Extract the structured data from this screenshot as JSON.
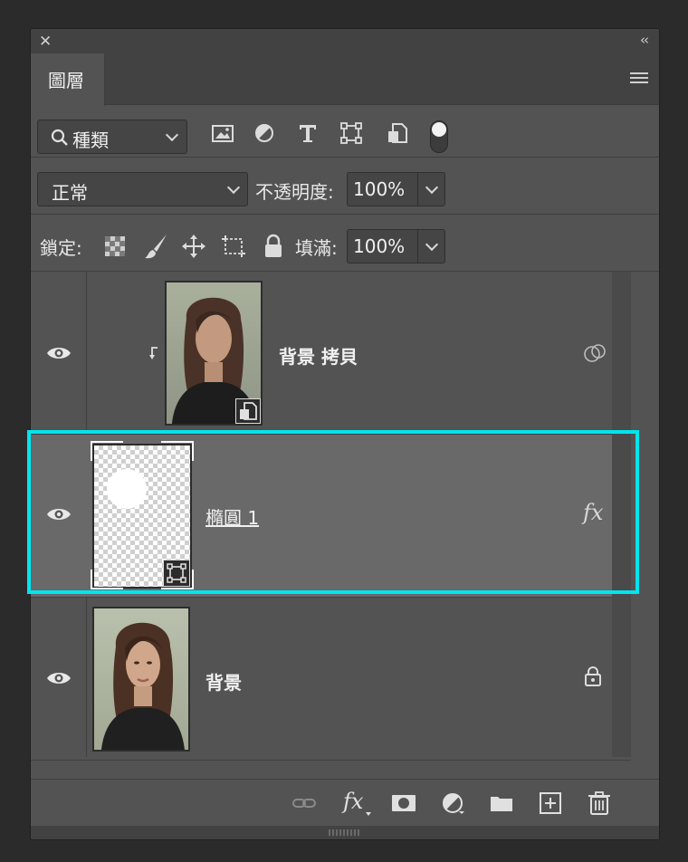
{
  "panel": {
    "tab_label": "圖層",
    "collapse_glyph": "‹‹",
    "close_glyph": "✕"
  },
  "filter": {
    "kind_label": "種類",
    "icons": [
      "image-filter-icon",
      "adjustment-filter-icon",
      "type-filter-icon",
      "shape-filter-icon",
      "smart-object-filter-icon",
      "filter-toggle-switch"
    ]
  },
  "blend": {
    "mode": "正常",
    "opacity_label": "不透明度:",
    "opacity_value": "100%"
  },
  "lock": {
    "label": "鎖定:",
    "icons": [
      "lock-transparent-pixels-icon",
      "lock-image-pixels-icon",
      "lock-position-icon",
      "lock-artboard-icon",
      "lock-all-icon"
    ],
    "fill_label": "填滿:",
    "fill_value": "100%"
  },
  "layers": [
    {
      "name": "背景 拷貝",
      "visible": true,
      "clipped": true,
      "right_icon": "blend-interior-icon",
      "thumb": "smart-object-portrait"
    },
    {
      "name": "橢圓 1",
      "visible": true,
      "selected": true,
      "right_icon": "fx-icon",
      "fx_label": "fx",
      "thumb": "shape-transparent"
    },
    {
      "name": "背景",
      "visible": true,
      "locked": true,
      "right_icon": "lock-icon",
      "thumb": "portrait"
    }
  ],
  "bottom_bar": {
    "fx_label": "fx",
    "icons": [
      "link-layers-icon",
      "add-layer-style-icon",
      "add-mask-icon",
      "new-fill-adjustment-icon",
      "new-group-icon",
      "new-layer-icon",
      "delete-layer-icon"
    ]
  },
  "colors": {
    "panel_bg": "#535353",
    "selected_bg": "#696969",
    "highlight": "#00e5ee"
  }
}
